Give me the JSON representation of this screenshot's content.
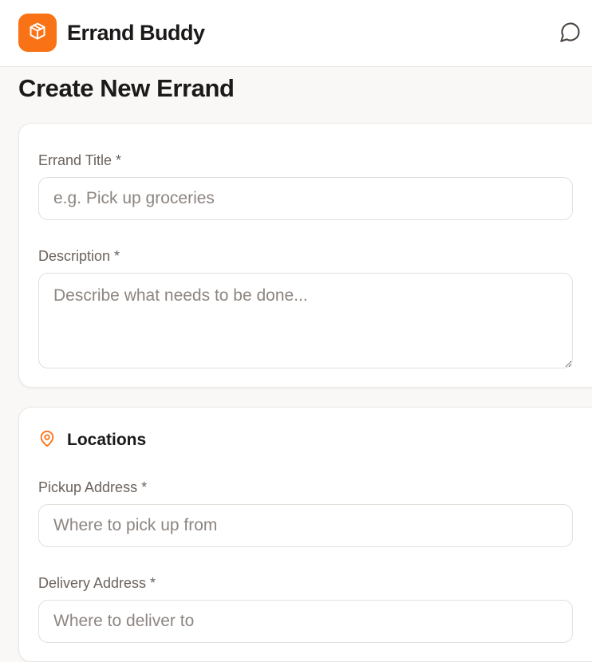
{
  "app": {
    "title": "Errand Buddy",
    "logo_icon": "package-icon",
    "chat_icon": "message-circle-icon",
    "accent_color": "#f97316"
  },
  "page": {
    "title": "Create New Errand"
  },
  "details": {
    "title_label": "Errand Title *",
    "title_placeholder": "e.g. Pick up groceries",
    "description_label": "Description *",
    "description_placeholder": "Describe what needs to be done..."
  },
  "locations": {
    "heading": "Locations",
    "heading_icon": "map-pin-icon",
    "pickup_label": "Pickup Address *",
    "pickup_placeholder": "Where to pick up from",
    "delivery_label": "Delivery Address *",
    "delivery_placeholder": "Where to deliver to"
  }
}
